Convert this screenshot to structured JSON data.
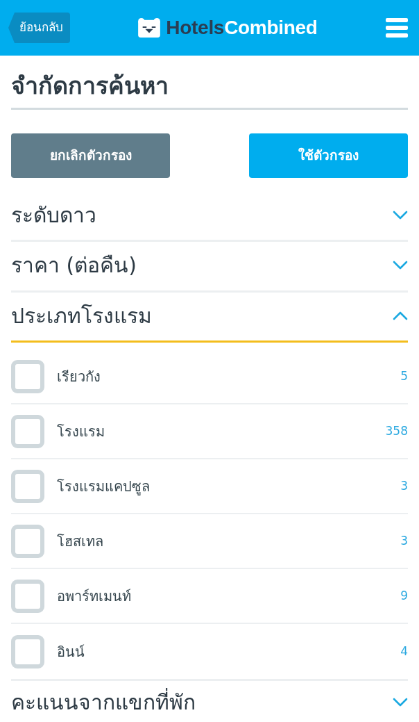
{
  "header": {
    "back_button": "ย้อนกลับ",
    "logo": [
      "Hotels",
      "Combined"
    ]
  },
  "title": "จำกัดการค้นหา",
  "buttons": [
    {
      "label": "ยกเลิกตัวกรอง",
      "kind": "secondary"
    },
    {
      "label": "ใช้ตัวกรอง",
      "kind": "primary"
    }
  ],
  "sections": [
    {
      "title": "ระดับดาว",
      "expanded": false
    },
    {
      "title": "ราคา (ต่อคืน)",
      "expanded": false
    },
    {
      "title": "ประเภทโรงแรม",
      "expanded": true,
      "options": [
        {
          "label": "เรียวกัง",
          "count": "5",
          "checked": false
        },
        {
          "label": "โรงแรม",
          "count": "358",
          "checked": false
        },
        {
          "label": "โรงแรมแคปซูล",
          "count": "3",
          "checked": false
        },
        {
          "label": "โฮสเทล",
          "count": "3",
          "checked": false
        },
        {
          "label": "อพาร์ทเมนท์",
          "count": "9",
          "checked": false
        },
        {
          "label": "อินน์",
          "count": "4",
          "checked": false
        }
      ]
    },
    {
      "title": "คะแนนจากแขกที่พัก",
      "expanded": false
    }
  ]
}
